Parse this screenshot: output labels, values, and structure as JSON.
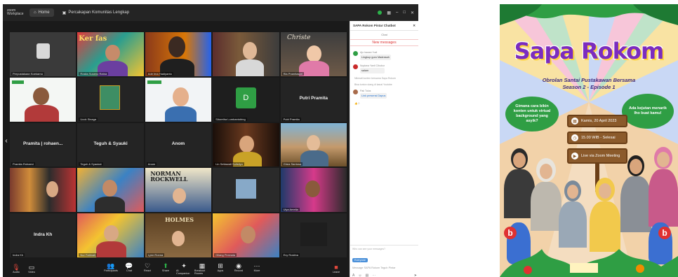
{
  "zoom": {
    "titlebar": {
      "app_label": "zoom Workplace",
      "tab_home": "Home",
      "meeting_chip": "Percakapan Komunitas Lengkap",
      "icons": [
        "shield-icon",
        "view-icon",
        "minimize-icon",
        "maximize-icon",
        "close-icon"
      ]
    },
    "tiles": [
      {
        "name": "Perpustakaan Soekarno",
        "big": ""
      },
      {
        "name": "Rosita Suseno Ratna",
        "big": ""
      },
      {
        "name": "Ade Ima Hadiyanto",
        "big": ""
      },
      {
        "name": "",
        "big": ""
      },
      {
        "name": "Ria Pramitasari",
        "big": ""
      },
      {
        "name": "",
        "big": ""
      },
      {
        "name": "Ucok Sinaga",
        "big": ""
      },
      {
        "name": "",
        "big": ""
      },
      {
        "name": "Sitoretha Lumbantobing",
        "big": "D"
      },
      {
        "name": "Putri Pramita",
        "big": "Putri Pramita"
      },
      {
        "name": "Pramita Rohaeni",
        "big": "Pramita | rohaen..."
      },
      {
        "name": "Teguh & Syaukat",
        "big": "Teguh & Syauki"
      },
      {
        "name": "Anom",
        "big": "Anom"
      },
      {
        "name": "Lin Setiawati Sulistiyo",
        "big": ""
      },
      {
        "name": "Ghea Santosa",
        "big": ""
      },
      {
        "name": "",
        "big": ""
      },
      {
        "name": "",
        "big": ""
      },
      {
        "name": "",
        "big": ""
      },
      {
        "name": "",
        "big": ""
      },
      {
        "name": "Ulya Amelia",
        "big": ""
      },
      {
        "name": "Indra Kh",
        "big": "Indra Kh"
      },
      {
        "name": "Nur Fatimah",
        "big": ""
      },
      {
        "name": "Lynn Ronna",
        "big": ""
      },
      {
        "name": "Gilang Permata",
        "big": ""
      },
      {
        "name": "Evy Rostina",
        "big": ""
      }
    ],
    "chat": {
      "header": "SAPA Rokom Pintar Chatbot",
      "sub": "Chat",
      "new_messages": "New messages",
      "messages": [
        {
          "who": "Ajo Irawan Yudi",
          "text": "Lingkup guru Madrasah"
        },
        {
          "who": "Nopiana Yanti Cibubur",
          "text": "salam"
        },
        {
          "who": "Pak Tulus",
          "text": "Link presensi Dapus"
        }
      ],
      "notes": [
        "Nikmati konten bersama Sapa Rokom",
        "Bisa tonton ulang di kanal Youtube"
      ],
      "reactions": "👍 2",
      "reply_note": "Who can see your messages?",
      "to_chip": "Everyone",
      "input_placeholder": "Message SAPA Rokom Teguh Pintar"
    },
    "toolbar": {
      "audio": "Audio",
      "video": "Video",
      "participants": "Participants",
      "chat": "Chat",
      "react": "React",
      "share": "Share",
      "ai_companion": "AI Companion",
      "breakout": "Breakout Rooms",
      "apps": "Apps",
      "record": "Record",
      "more": "More",
      "leave": "Leave"
    }
  },
  "poster": {
    "title": "Sapa Rokom",
    "tagline": "Obrolan Santai Pustakawan Bersama",
    "episode": "Season 2 - Episode 1",
    "bubble_left": "Gimana cara bikin konten untuk virtual background yang asyik?",
    "bubble_right": "Ada kejutan menarik lho buat kamu!",
    "date": "Kamis, 20 April 2023",
    "time": "15.00 WIB - Selesai",
    "location": "Live via Zoom Meeting",
    "colors": {
      "title": "#7b2cbf",
      "green": "#2f9e44",
      "sign": "#8b5a2b"
    }
  }
}
